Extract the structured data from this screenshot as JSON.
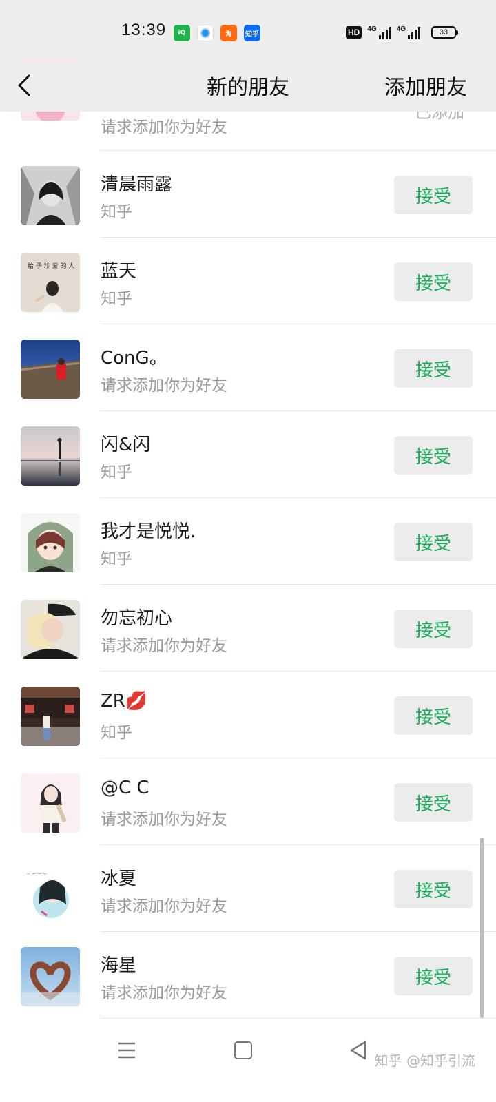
{
  "status_bar": {
    "time": "13:39",
    "app_icons": [
      "iqiyi-icon",
      "browser-icon",
      "taobao-icon",
      "zhihu-icon"
    ],
    "zhihu_icon_text": "知乎",
    "hd_badge": "HD",
    "network_1": "4G",
    "network_2": "4G",
    "battery": "33"
  },
  "header": {
    "title": "新的朋友",
    "add_button": "添加朋友"
  },
  "colors": {
    "accent": "#1aad5a",
    "header_bg": "#ededed",
    "button_bg": "#ececec",
    "subtext": "#9a9a9a"
  },
  "friends": [
    {
      "name": "",
      "subtitle": "请求添加你为好友",
      "action": "已添加",
      "status": "added"
    },
    {
      "name": "清晨雨露",
      "subtitle": "知乎",
      "action": "接受"
    },
    {
      "name": "蓝天",
      "subtitle": "知乎",
      "action": "接受"
    },
    {
      "name": "ConG。",
      "subtitle": "请求添加你为好友",
      "action": "接受"
    },
    {
      "name": "闪&闪",
      "subtitle": "知乎",
      "action": "接受"
    },
    {
      "name": "我才是悦悦.",
      "subtitle": "知乎",
      "action": "接受"
    },
    {
      "name": "勿忘初心",
      "subtitle": "请求添加你为好友",
      "action": "接受"
    },
    {
      "name": "ZR💋",
      "subtitle": "知乎",
      "action": "接受"
    },
    {
      "name": "@C C",
      "subtitle": "请求添加你为好友",
      "action": "接受"
    },
    {
      "name": "冰夏",
      "subtitle": "请求添加你为好友",
      "action": "接受"
    },
    {
      "name": "海星",
      "subtitle": "请求添加你为好友",
      "action": "接受"
    }
  ],
  "bottom_nav": {
    "icons": [
      "menu-icon",
      "home-icon",
      "back-triangle-icon"
    ],
    "watermark": "知乎 @知乎引流"
  }
}
